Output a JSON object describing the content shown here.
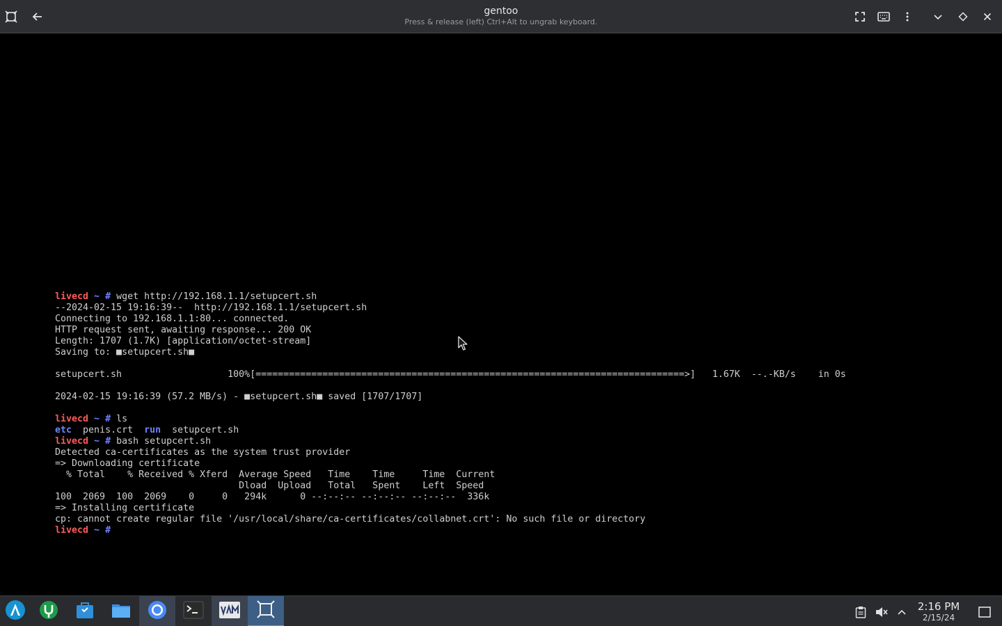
{
  "window": {
    "title": "gentoo",
    "subtitle": "Press & release (left) Ctrl+Alt to ungrab keyboard.",
    "icons": [
      "app-menu-icon",
      "back-arrow-icon",
      "fullscreen-icon",
      "keyboard-icon",
      "more-options-icon",
      "minimize-icon",
      "maximize-icon",
      "close-icon"
    ]
  },
  "terminal": {
    "prompt_host": "livecd",
    "prompt_path": " ~ #",
    "lines": [
      {
        "kind": "prompt",
        "cmd": " wget http://192.168.1.1/setupcert.sh"
      },
      {
        "kind": "text",
        "text": "--2024-02-15 19:16:39--  http://192.168.1.1/setupcert.sh"
      },
      {
        "kind": "text",
        "text": "Connecting to 192.168.1.1:80... connected."
      },
      {
        "kind": "text",
        "text": "HTTP request sent, awaiting response... 200 OK"
      },
      {
        "kind": "text",
        "text": "Length: 1707 (1.7K) [application/octet-stream]"
      },
      {
        "kind": "text",
        "text": "Saving to: ■setupcert.sh■"
      },
      {
        "kind": "text",
        "text": ""
      },
      {
        "kind": "text",
        "text": "setupcert.sh                   100%[=============================================================================>]   1.67K  --.-KB/s    in 0s"
      },
      {
        "kind": "text",
        "text": ""
      },
      {
        "kind": "text",
        "text": "2024-02-15 19:16:39 (57.2 MB/s) - ■setupcert.sh■ saved [1707/1707]"
      },
      {
        "kind": "text",
        "text": ""
      },
      {
        "kind": "prompt",
        "cmd": " ls"
      },
      {
        "kind": "ls",
        "items": [
          {
            "name": "etc",
            "dir": true,
            "sep": "  "
          },
          {
            "name": "penis.crt",
            "dir": false,
            "sep": "  "
          },
          {
            "name": "run",
            "dir": true,
            "sep": "  "
          },
          {
            "name": "setupcert.sh",
            "dir": false,
            "sep": ""
          }
        ]
      },
      {
        "kind": "prompt",
        "cmd": " bash setupcert.sh"
      },
      {
        "kind": "text",
        "text": "Detected ca-certificates as the system trust provider"
      },
      {
        "kind": "text",
        "text": "=> Downloading certificate"
      },
      {
        "kind": "text",
        "text": "  % Total    % Received % Xferd  Average Speed   Time    Time     Time  Current"
      },
      {
        "kind": "text",
        "text": "                                 Dload  Upload   Total   Spent    Left  Speed"
      },
      {
        "kind": "text",
        "text": "100  2069  100  2069    0     0   294k      0 --:--:-- --:--:-- --:--:--  336k"
      },
      {
        "kind": "text",
        "text": "=> Installing certificate"
      },
      {
        "kind": "text",
        "text": "cp: cannot create regular file '/usr/local/share/ca-certificates/collabnet.crt': No such file or directory"
      },
      {
        "kind": "prompt",
        "cmd": ""
      }
    ]
  },
  "taskbar": {
    "apps": [
      {
        "name": "app-launcher-icon",
        "active": false
      },
      {
        "name": "discover-icon",
        "active": false
      },
      {
        "name": "software-store-icon",
        "active": false
      },
      {
        "name": "file-manager-icon",
        "active": false
      },
      {
        "name": "chromium-icon",
        "active": true
      },
      {
        "name": "terminal-icon",
        "active": false
      },
      {
        "name": "virt-manager-icon",
        "active": true
      },
      {
        "name": "vm-viewer-icon",
        "active": true
      }
    ],
    "tray": [
      "clipboard-icon",
      "volume-muted-icon",
      "tray-expand-icon",
      "show-desktop-icon"
    ],
    "clock": {
      "time": "2:16 PM",
      "date": "2/15/24"
    },
    "accent": "#3daee9"
  }
}
